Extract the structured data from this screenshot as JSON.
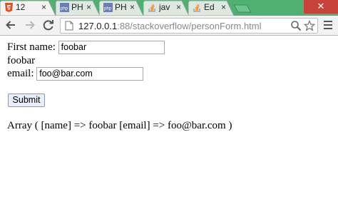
{
  "tabs": [
    {
      "title": "12",
      "icon": "html5-icon",
      "active": true
    },
    {
      "title": "PH",
      "icon": "php-icon",
      "active": false
    },
    {
      "title": "PH",
      "icon": "php-icon",
      "active": false
    },
    {
      "title": "jav",
      "icon": "stack-overflow-icon",
      "active": false
    },
    {
      "title": "Ed",
      "icon": "stack-overflow-icon",
      "active": false
    }
  ],
  "tab_close_glyph": "×",
  "window": {
    "close_glyph": "✕"
  },
  "toolbar": {
    "url_host": "127.0.0.1",
    "url_path": ":88/stackoverflow/personForm.html"
  },
  "form": {
    "first_name_label": "First name:",
    "first_name_value": "foobar",
    "echo_text": "foobar",
    "email_label": "email:",
    "email_value": "foo@bar.com",
    "submit_label": "Submit"
  },
  "output_text": "Array ( [name] => foobar [email] => foo@bar.com )",
  "colors": {
    "tabstrip": "#4fb071",
    "close_button": "#c7433a"
  }
}
